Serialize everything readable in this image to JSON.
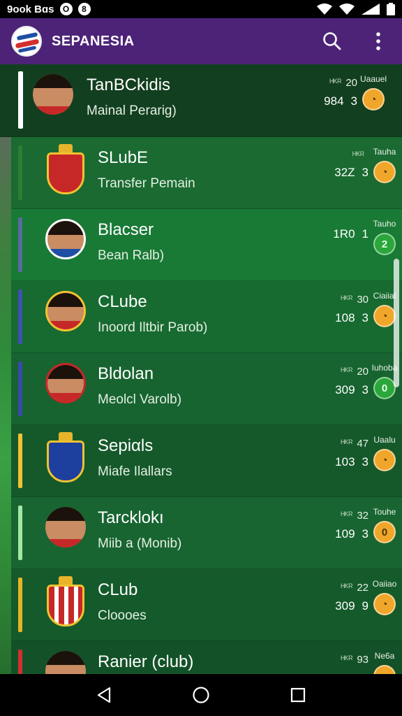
{
  "status_bar": {
    "time_text": "9ᴏok Bɑs",
    "icon_left_1": "O",
    "icon_left_2": "8"
  },
  "app_bar": {
    "title": "SEPANESIA"
  },
  "rows": [
    {
      "main": "TanBCkidis",
      "sub": "Mainal Perarig)",
      "stat_top_label": "ᴴᴷᴿ",
      "stat_top_num": "20",
      "stat_a": "984",
      "stat_b": "3",
      "badge_label": "Uaauel",
      "badge_text": "◔",
      "badge_color": "orange",
      "accent": "#ffffff",
      "avatar": "face"
    },
    {
      "main": "SLubE",
      "sub": "Transfer Pemain",
      "stat_top_label": "ᴴᴷᴿ",
      "stat_top_num": "",
      "stat_a": "32Z",
      "stat_b": "3",
      "badge_label": "Tauha",
      "badge_text": "◔",
      "badge_color": "orange",
      "accent": "#2e7d32",
      "avatar": "crest-red"
    },
    {
      "main": "Blacser",
      "sub": "Bean Ralb)",
      "stat_top_label": "",
      "stat_top_num": "",
      "stat_a": "1R0",
      "stat_b": "1",
      "badge_label": "Tauho",
      "badge_text": "2",
      "badge_color": "green",
      "accent": "#5a6a9e",
      "avatar": "face-ring"
    },
    {
      "main": "CLube",
      "sub": "Inoord Iltbir Parob)",
      "stat_top_label": "ᴴᴷᴿ",
      "stat_top_num": "30",
      "stat_a": "108",
      "stat_b": "3",
      "badge_label": "Ciaiial",
      "badge_text": "◔",
      "badge_color": "orange",
      "accent": "#3f51b5",
      "avatar": "face-crest"
    },
    {
      "main": "Bldolan",
      "sub": "Meolcl Varolb)",
      "stat_top_label": "ᴴᴷᴿ",
      "stat_top_num": "20",
      "stat_a": "309",
      "stat_b": "3",
      "badge_label": "Iuhoba",
      "badge_text": "0",
      "badge_color": "green",
      "accent": "#3949ab",
      "avatar": "face-crest-blue"
    },
    {
      "main": "Sepiαls",
      "sub": "Miafe Ilallars",
      "stat_top_label": "ᴴᴷᴿ",
      "stat_top_num": "47",
      "stat_a": "103",
      "stat_b": "3",
      "badge_label": "Uaalu",
      "badge_text": "◔",
      "badge_color": "orange",
      "accent": "#f2c230",
      "avatar": "crest-blue"
    },
    {
      "main": "Tarcklokı",
      "sub": "Miib a (Monib)",
      "stat_top_label": "ᴴᴷᴿ",
      "stat_top_num": "32",
      "stat_a": "109",
      "stat_b": "3",
      "badge_label": "Touhe",
      "badge_text": "0",
      "badge_color": "orange",
      "accent": "#a5e6a5",
      "avatar": "face"
    },
    {
      "main": "CLub",
      "sub": "Cloooes",
      "stat_top_label": "ᴴᴷᴿ",
      "stat_top_num": "22",
      "stat_a": "309",
      "stat_b": "9",
      "badge_label": "Oaiiao",
      "badge_text": "◔",
      "badge_color": "orange",
      "accent": "#e6b422",
      "avatar": "crest-redwhite"
    },
    {
      "main": "Ranier (club)",
      "sub": "",
      "stat_top_label": "ᴴᴷᴿ",
      "stat_top_num": "93",
      "stat_a": "",
      "stat_b": "",
      "badge_label": "Ne6a",
      "badge_text": "",
      "badge_color": "orange",
      "accent": "#d32f2f",
      "avatar": "face"
    }
  ],
  "colors": {
    "app_bar": "#4d2378",
    "list_bg": "#1c5c2c",
    "badge_orange": "#f0a62a",
    "badge_green": "#2aa63b"
  }
}
